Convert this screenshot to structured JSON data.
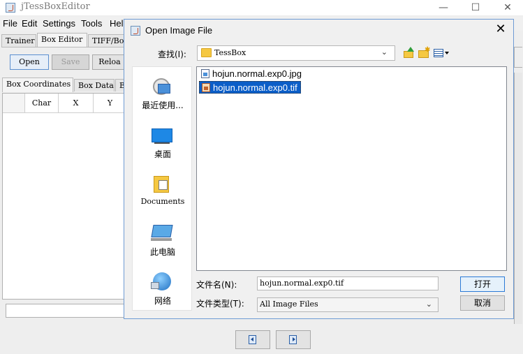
{
  "main": {
    "title": "jTessBoxEditor",
    "menu": [
      "File",
      "Edit",
      "Settings",
      "Tools",
      "Hel"
    ],
    "tabs": [
      "Trainer",
      "Box Editor",
      "TIFF/Box"
    ],
    "buttons": {
      "open": "Open",
      "save": "Save",
      "reload": "Reloa"
    },
    "subtabs": [
      "Box Coordinates",
      "Box Data",
      "B"
    ],
    "columns": [
      "Char",
      "X",
      "Y"
    ]
  },
  "dialog": {
    "title": "Open Image File",
    "look_in_label": "查找(I):",
    "look_in_value": "TessBox",
    "places": [
      "最近使用...",
      "桌面",
      "Documents",
      "此电脑",
      "网络"
    ],
    "files": [
      {
        "name": "hojun.normal.exp0.jpg",
        "selected": false
      },
      {
        "name": "hojun.normal.exp0.tif",
        "selected": true
      }
    ],
    "filename_label": "文件名(N):",
    "filename_value": "hojun.normal.exp0.tif",
    "filetype_label": "文件类型(T):",
    "filetype_value": "All Image Files",
    "open_button": "打开",
    "cancel_button": "取消"
  },
  "colors": {
    "selection": "#0b5ec8",
    "dialog_border": "#6e9bd4",
    "folder": "#f5c842"
  }
}
